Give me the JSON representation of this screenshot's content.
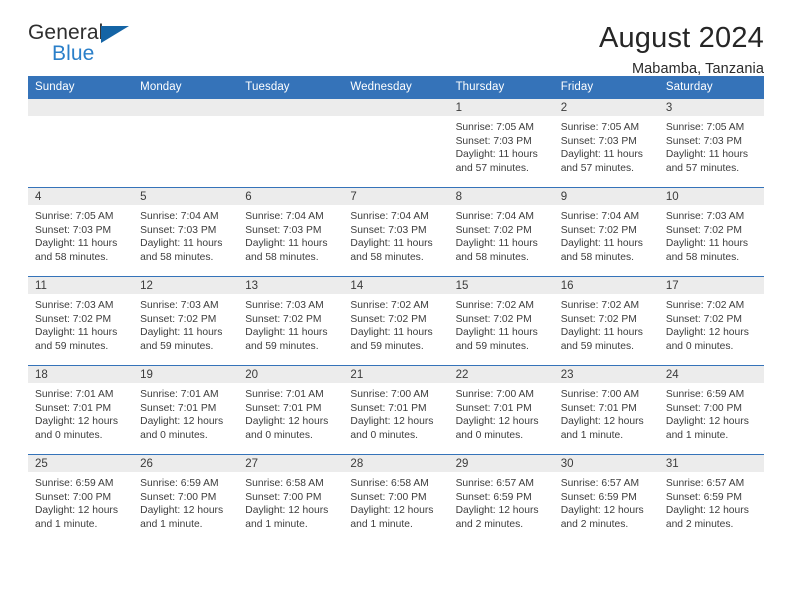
{
  "brand": {
    "name_part1": "General",
    "name_part2": "Blue",
    "triangle_color": "#1464a5",
    "blue_text_color": "#2a7fc9"
  },
  "header": {
    "title": "August 2024",
    "subtitle": "Mabamba, Tanzania"
  },
  "theme": {
    "header_blue": "#3573b9",
    "daynum_band": "#ececec",
    "text": "#3d3d3d"
  },
  "weekday_headers": [
    "Sunday",
    "Monday",
    "Tuesday",
    "Wednesday",
    "Thursday",
    "Friday",
    "Saturday"
  ],
  "labels": {
    "sunrise_prefix": "Sunrise:",
    "sunset_prefix": "Sunset:",
    "daylight_prefix": "Daylight:"
  },
  "weeks": [
    [
      {
        "day": "",
        "sunrise": "",
        "sunset": "",
        "daylight_line1": "",
        "daylight_line2": "",
        "empty": true
      },
      {
        "day": "",
        "sunrise": "",
        "sunset": "",
        "daylight_line1": "",
        "daylight_line2": "",
        "empty": true
      },
      {
        "day": "",
        "sunrise": "",
        "sunset": "",
        "daylight_line1": "",
        "daylight_line2": "",
        "empty": true
      },
      {
        "day": "",
        "sunrise": "",
        "sunset": "",
        "daylight_line1": "",
        "daylight_line2": "",
        "empty": true
      },
      {
        "day": "1",
        "sunrise": "Sunrise: 7:05 AM",
        "sunset": "Sunset: 7:03 PM",
        "daylight_line1": "Daylight: 11 hours",
        "daylight_line2": "and 57 minutes.",
        "empty": false
      },
      {
        "day": "2",
        "sunrise": "Sunrise: 7:05 AM",
        "sunset": "Sunset: 7:03 PM",
        "daylight_line1": "Daylight: 11 hours",
        "daylight_line2": "and 57 minutes.",
        "empty": false
      },
      {
        "day": "3",
        "sunrise": "Sunrise: 7:05 AM",
        "sunset": "Sunset: 7:03 PM",
        "daylight_line1": "Daylight: 11 hours",
        "daylight_line2": "and 57 minutes.",
        "empty": false
      }
    ],
    [
      {
        "day": "4",
        "sunrise": "Sunrise: 7:05 AM",
        "sunset": "Sunset: 7:03 PM",
        "daylight_line1": "Daylight: 11 hours",
        "daylight_line2": "and 58 minutes.",
        "empty": false
      },
      {
        "day": "5",
        "sunrise": "Sunrise: 7:04 AM",
        "sunset": "Sunset: 7:03 PM",
        "daylight_line1": "Daylight: 11 hours",
        "daylight_line2": "and 58 minutes.",
        "empty": false
      },
      {
        "day": "6",
        "sunrise": "Sunrise: 7:04 AM",
        "sunset": "Sunset: 7:03 PM",
        "daylight_line1": "Daylight: 11 hours",
        "daylight_line2": "and 58 minutes.",
        "empty": false
      },
      {
        "day": "7",
        "sunrise": "Sunrise: 7:04 AM",
        "sunset": "Sunset: 7:03 PM",
        "daylight_line1": "Daylight: 11 hours",
        "daylight_line2": "and 58 minutes.",
        "empty": false
      },
      {
        "day": "8",
        "sunrise": "Sunrise: 7:04 AM",
        "sunset": "Sunset: 7:02 PM",
        "daylight_line1": "Daylight: 11 hours",
        "daylight_line2": "and 58 minutes.",
        "empty": false
      },
      {
        "day": "9",
        "sunrise": "Sunrise: 7:04 AM",
        "sunset": "Sunset: 7:02 PM",
        "daylight_line1": "Daylight: 11 hours",
        "daylight_line2": "and 58 minutes.",
        "empty": false
      },
      {
        "day": "10",
        "sunrise": "Sunrise: 7:03 AM",
        "sunset": "Sunset: 7:02 PM",
        "daylight_line1": "Daylight: 11 hours",
        "daylight_line2": "and 58 minutes.",
        "empty": false
      }
    ],
    [
      {
        "day": "11",
        "sunrise": "Sunrise: 7:03 AM",
        "sunset": "Sunset: 7:02 PM",
        "daylight_line1": "Daylight: 11 hours",
        "daylight_line2": "and 59 minutes.",
        "empty": false
      },
      {
        "day": "12",
        "sunrise": "Sunrise: 7:03 AM",
        "sunset": "Sunset: 7:02 PM",
        "daylight_line1": "Daylight: 11 hours",
        "daylight_line2": "and 59 minutes.",
        "empty": false
      },
      {
        "day": "13",
        "sunrise": "Sunrise: 7:03 AM",
        "sunset": "Sunset: 7:02 PM",
        "daylight_line1": "Daylight: 11 hours",
        "daylight_line2": "and 59 minutes.",
        "empty": false
      },
      {
        "day": "14",
        "sunrise": "Sunrise: 7:02 AM",
        "sunset": "Sunset: 7:02 PM",
        "daylight_line1": "Daylight: 11 hours",
        "daylight_line2": "and 59 minutes.",
        "empty": false
      },
      {
        "day": "15",
        "sunrise": "Sunrise: 7:02 AM",
        "sunset": "Sunset: 7:02 PM",
        "daylight_line1": "Daylight: 11 hours",
        "daylight_line2": "and 59 minutes.",
        "empty": false
      },
      {
        "day": "16",
        "sunrise": "Sunrise: 7:02 AM",
        "sunset": "Sunset: 7:02 PM",
        "daylight_line1": "Daylight: 11 hours",
        "daylight_line2": "and 59 minutes.",
        "empty": false
      },
      {
        "day": "17",
        "sunrise": "Sunrise: 7:02 AM",
        "sunset": "Sunset: 7:02 PM",
        "daylight_line1": "Daylight: 12 hours",
        "daylight_line2": "and 0 minutes.",
        "empty": false
      }
    ],
    [
      {
        "day": "18",
        "sunrise": "Sunrise: 7:01 AM",
        "sunset": "Sunset: 7:01 PM",
        "daylight_line1": "Daylight: 12 hours",
        "daylight_line2": "and 0 minutes.",
        "empty": false
      },
      {
        "day": "19",
        "sunrise": "Sunrise: 7:01 AM",
        "sunset": "Sunset: 7:01 PM",
        "daylight_line1": "Daylight: 12 hours",
        "daylight_line2": "and 0 minutes.",
        "empty": false
      },
      {
        "day": "20",
        "sunrise": "Sunrise: 7:01 AM",
        "sunset": "Sunset: 7:01 PM",
        "daylight_line1": "Daylight: 12 hours",
        "daylight_line2": "and 0 minutes.",
        "empty": false
      },
      {
        "day": "21",
        "sunrise": "Sunrise: 7:00 AM",
        "sunset": "Sunset: 7:01 PM",
        "daylight_line1": "Daylight: 12 hours",
        "daylight_line2": "and 0 minutes.",
        "empty": false
      },
      {
        "day": "22",
        "sunrise": "Sunrise: 7:00 AM",
        "sunset": "Sunset: 7:01 PM",
        "daylight_line1": "Daylight: 12 hours",
        "daylight_line2": "and 0 minutes.",
        "empty": false
      },
      {
        "day": "23",
        "sunrise": "Sunrise: 7:00 AM",
        "sunset": "Sunset: 7:01 PM",
        "daylight_line1": "Daylight: 12 hours",
        "daylight_line2": "and 1 minute.",
        "empty": false
      },
      {
        "day": "24",
        "sunrise": "Sunrise: 6:59 AM",
        "sunset": "Sunset: 7:00 PM",
        "daylight_line1": "Daylight: 12 hours",
        "daylight_line2": "and 1 minute.",
        "empty": false
      }
    ],
    [
      {
        "day": "25",
        "sunrise": "Sunrise: 6:59 AM",
        "sunset": "Sunset: 7:00 PM",
        "daylight_line1": "Daylight: 12 hours",
        "daylight_line2": "and 1 minute.",
        "empty": false
      },
      {
        "day": "26",
        "sunrise": "Sunrise: 6:59 AM",
        "sunset": "Sunset: 7:00 PM",
        "daylight_line1": "Daylight: 12 hours",
        "daylight_line2": "and 1 minute.",
        "empty": false
      },
      {
        "day": "27",
        "sunrise": "Sunrise: 6:58 AM",
        "sunset": "Sunset: 7:00 PM",
        "daylight_line1": "Daylight: 12 hours",
        "daylight_line2": "and 1 minute.",
        "empty": false
      },
      {
        "day": "28",
        "sunrise": "Sunrise: 6:58 AM",
        "sunset": "Sunset: 7:00 PM",
        "daylight_line1": "Daylight: 12 hours",
        "daylight_line2": "and 1 minute.",
        "empty": false
      },
      {
        "day": "29",
        "sunrise": "Sunrise: 6:57 AM",
        "sunset": "Sunset: 6:59 PM",
        "daylight_line1": "Daylight: 12 hours",
        "daylight_line2": "and 2 minutes.",
        "empty": false
      },
      {
        "day": "30",
        "sunrise": "Sunrise: 6:57 AM",
        "sunset": "Sunset: 6:59 PM",
        "daylight_line1": "Daylight: 12 hours",
        "daylight_line2": "and 2 minutes.",
        "empty": false
      },
      {
        "day": "31",
        "sunrise": "Sunrise: 6:57 AM",
        "sunset": "Sunset: 6:59 PM",
        "daylight_line1": "Daylight: 12 hours",
        "daylight_line2": "and 2 minutes.",
        "empty": false
      }
    ]
  ]
}
